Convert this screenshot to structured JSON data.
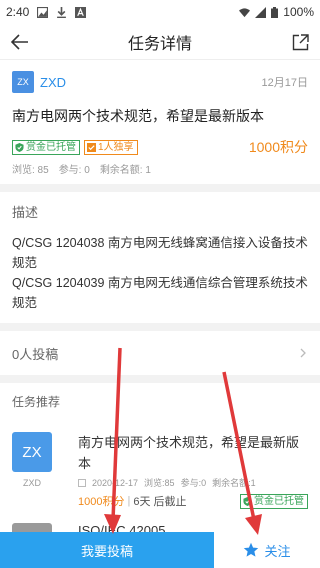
{
  "status_bar": {
    "time": "2:40",
    "battery": "100%"
  },
  "app_bar": {
    "title": "任务详情"
  },
  "task": {
    "user_avatar": "ZX",
    "user_name": "ZXD",
    "date": "12月17日",
    "title": "南方电网两个技术规范，希望是最新版本",
    "tags": [
      "赏金已托管",
      "1人独享"
    ],
    "points": "1000积分",
    "views": "浏览: 85",
    "participants": "参与: 0",
    "remaining": "剩余名额: 1"
  },
  "description": {
    "label": "描述",
    "text": "Q/CSG 1204038 南方电网无线蜂窝通信接入设备技术规范\nQ/CSG 1204039 南方电网无线通信综合管理系统技术规范"
  },
  "submissions": {
    "label": "0人投稿"
  },
  "recommend": {
    "label": "任务推荐",
    "items": [
      {
        "avatar": "ZX",
        "avatar_name": "ZXD",
        "title": "南方电网两个技术规范，希望是最新版本",
        "date": "2020-12-17",
        "views": "浏览:85",
        "participants": "参与:0",
        "remaining": "剩余名额:1",
        "points": "1000积分",
        "deadline": "6天 后截止",
        "tag": "赏金已托管"
      },
      {
        "title": "ISO/IEC 42005"
      }
    ]
  },
  "bottom": {
    "submit_label": "我要投稿",
    "follow_label": "关注"
  },
  "colors": {
    "accent": "#2aa1ee",
    "points": "#f08a1c",
    "escrow": "#3aa55a",
    "annotation_arrow": "#e0393a"
  }
}
